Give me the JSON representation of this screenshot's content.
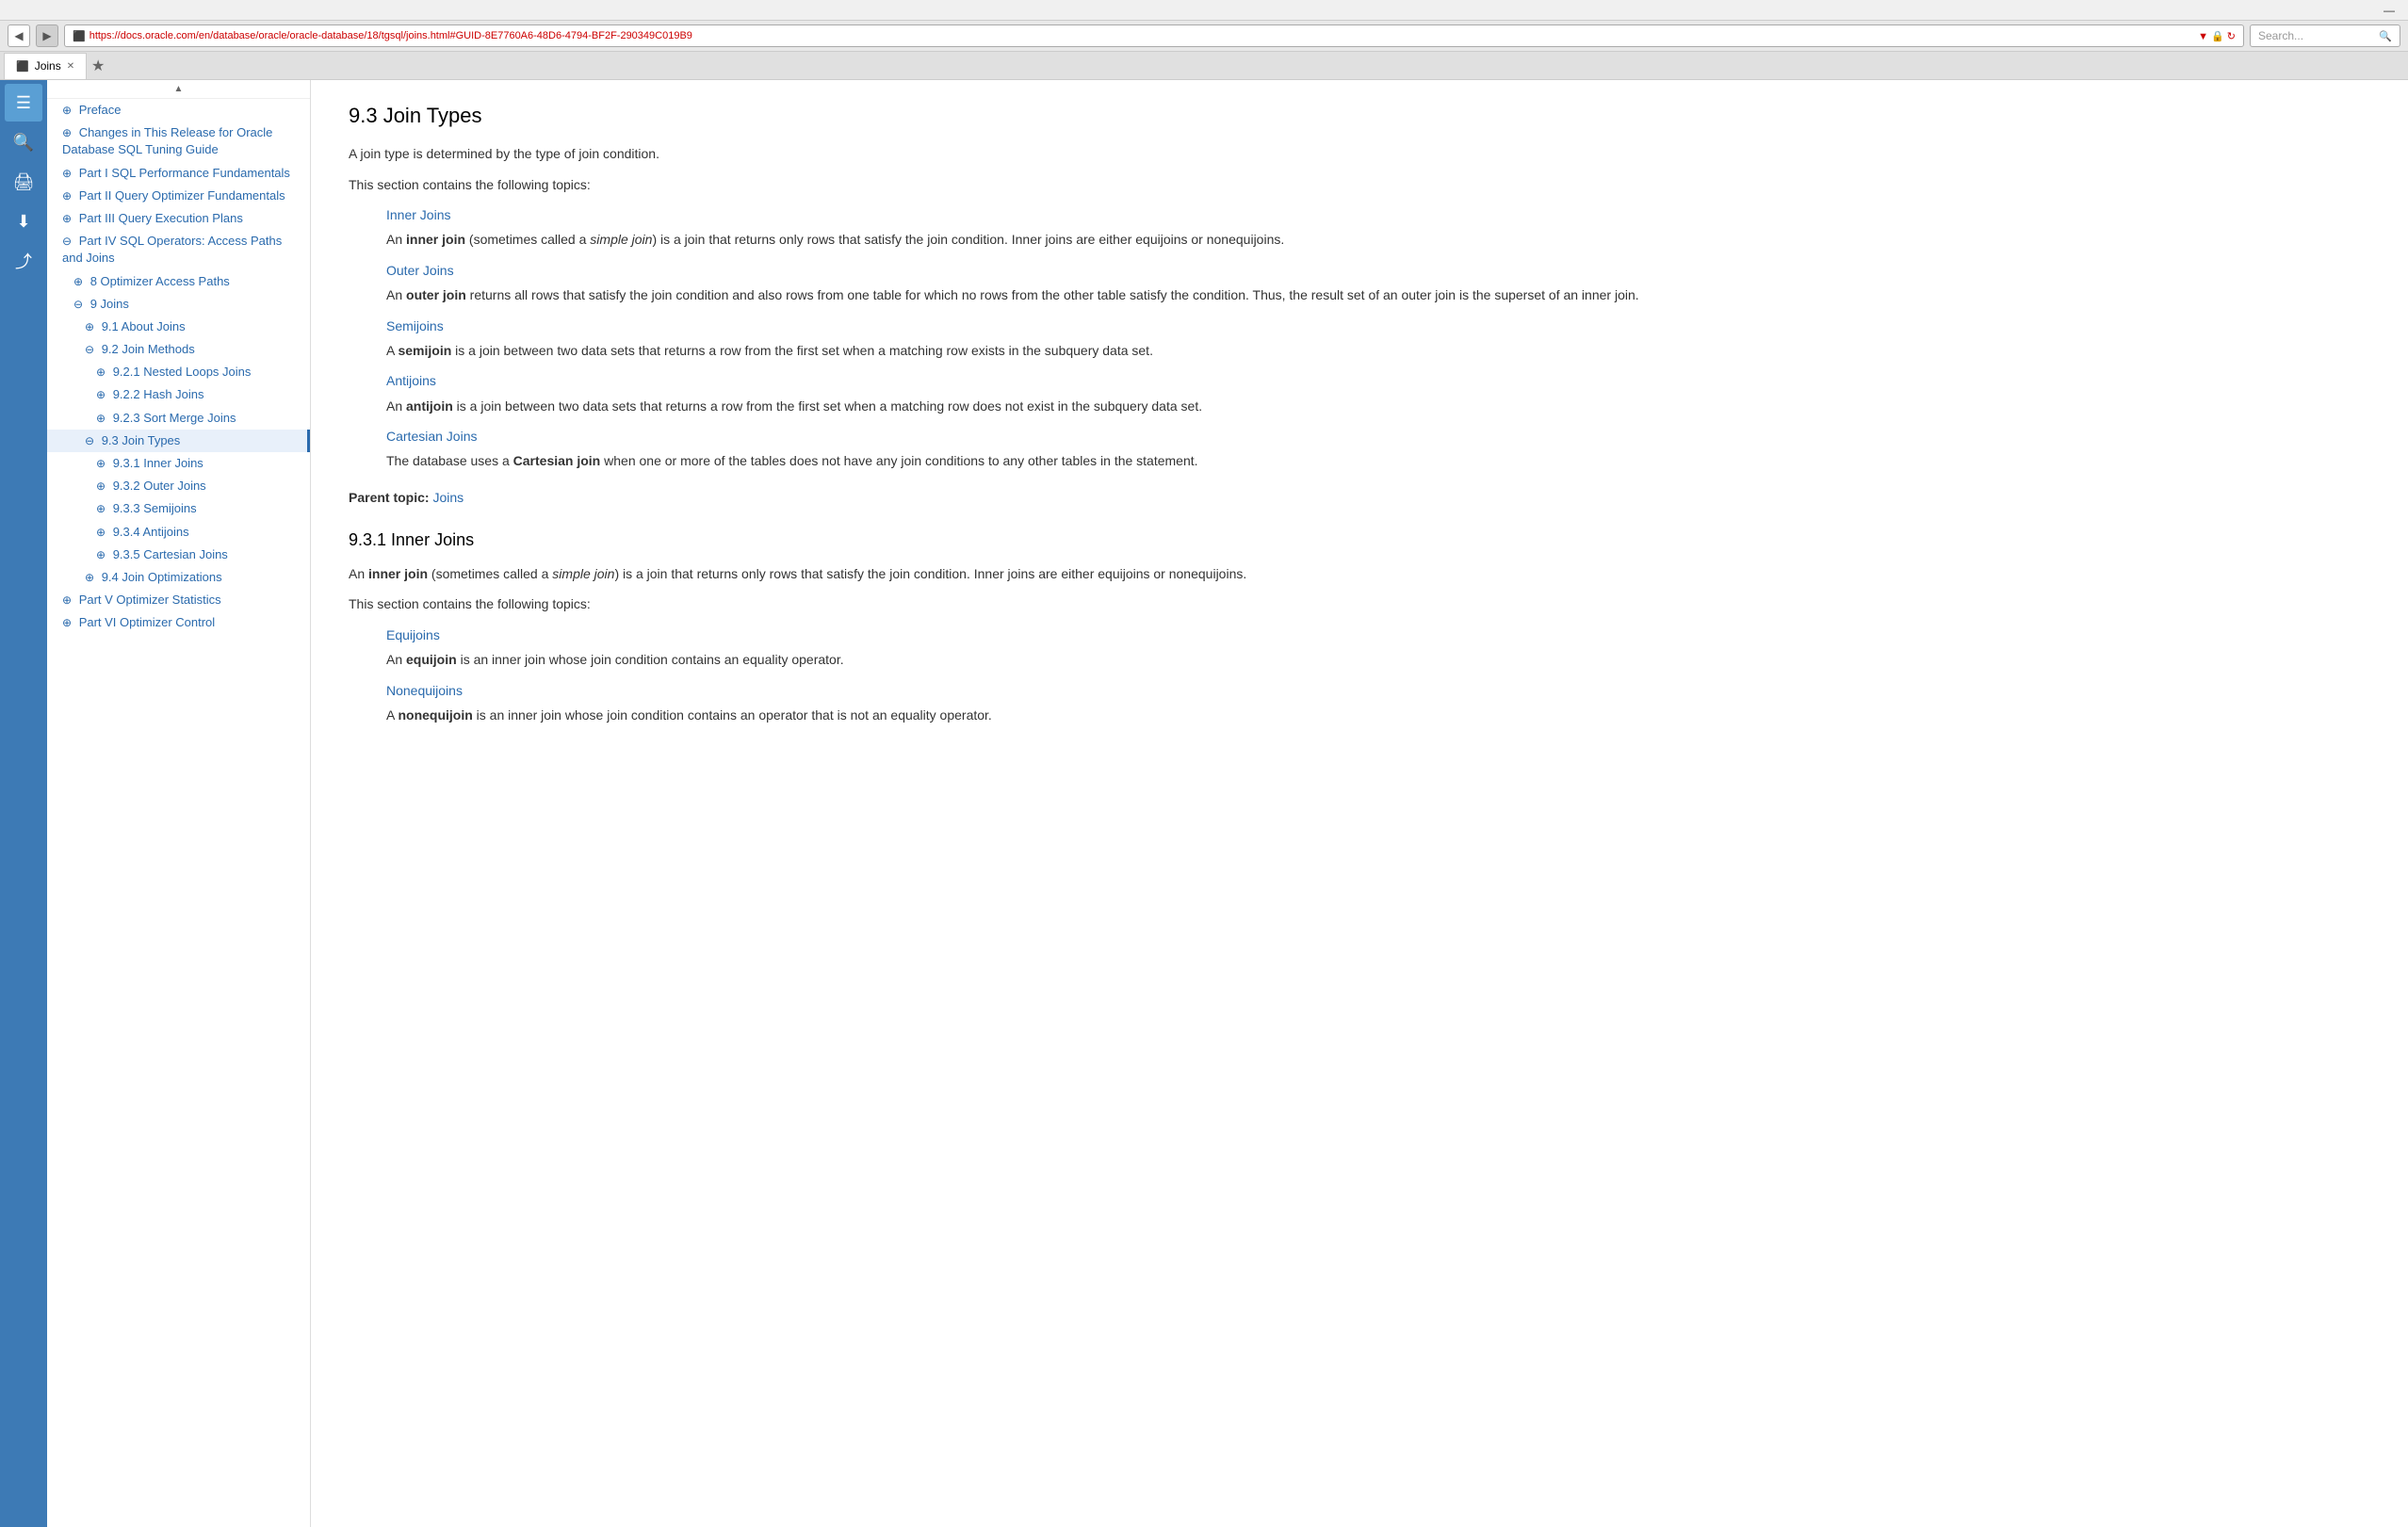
{
  "titlebar": {
    "minimize": "—"
  },
  "browser": {
    "back_icon": "◀",
    "forward_icon": "▶",
    "favicon": "⬛",
    "url": "https://docs.oracle.com/en/database/oracle/oracle-database/18/tgsql/joins.html#GUID-8E7760A6-48D6-4794-BF2F-290349C019B9",
    "lock_icon": "🔒",
    "refresh_icon": "↻",
    "search_placeholder": "Search...",
    "search_icon": "🔍"
  },
  "tab": {
    "favicon": "⬛",
    "label": "Joins",
    "close": "✕",
    "new_tab": "★"
  },
  "sidebar_icons": [
    {
      "name": "menu-icon",
      "glyph": "☰"
    },
    {
      "name": "search-icon",
      "glyph": "🔍"
    },
    {
      "name": "print-icon",
      "glyph": "🖨"
    },
    {
      "name": "download-icon",
      "glyph": "⬇"
    },
    {
      "name": "share-icon",
      "glyph": "⤴"
    }
  ],
  "toc": {
    "scroll_up": "▲",
    "items": [
      {
        "id": "preface",
        "level": 1,
        "icon": "plus",
        "label": "Preface",
        "active": false
      },
      {
        "id": "changes",
        "level": 1,
        "icon": "plus",
        "label": "Changes in This Release for Oracle Database SQL Tuning Guide",
        "active": false
      },
      {
        "id": "part1",
        "level": 1,
        "icon": "plus",
        "label": "Part I SQL Performance Fundamentals",
        "active": false
      },
      {
        "id": "part2",
        "level": 1,
        "icon": "plus",
        "label": "Part II Query Optimizer Fundamentals",
        "active": false
      },
      {
        "id": "part3",
        "level": 1,
        "icon": "plus",
        "label": "Part III Query Execution Plans",
        "active": false
      },
      {
        "id": "part4",
        "level": 1,
        "icon": "minus",
        "label": "Part IV SQL Operators: Access Paths and Joins",
        "active": false
      },
      {
        "id": "ch8",
        "level": 2,
        "icon": "plus",
        "label": "8 Optimizer Access Paths",
        "active": false
      },
      {
        "id": "ch9",
        "level": 2,
        "icon": "minus",
        "label": "9 Joins",
        "active": false
      },
      {
        "id": "sec91",
        "level": 3,
        "icon": "plus",
        "label": "9.1 About Joins",
        "active": false
      },
      {
        "id": "sec92",
        "level": 3,
        "icon": "minus",
        "label": "9.2 Join Methods",
        "active": false
      },
      {
        "id": "sec921",
        "level": 4,
        "icon": "plus",
        "label": "9.2.1 Nested Loops Joins",
        "active": false
      },
      {
        "id": "sec922",
        "level": 4,
        "icon": "plus",
        "label": "9.2.2 Hash Joins",
        "active": false
      },
      {
        "id": "sec923",
        "level": 4,
        "icon": "plus",
        "label": "9.2.3 Sort Merge Joins",
        "active": false
      },
      {
        "id": "sec93",
        "level": 3,
        "icon": "minus",
        "label": "9.3 Join Types",
        "active": true
      },
      {
        "id": "sec931",
        "level": 4,
        "icon": "plus",
        "label": "9.3.1 Inner Joins",
        "active": false
      },
      {
        "id": "sec932",
        "level": 4,
        "icon": "plus",
        "label": "9.3.2 Outer Joins",
        "active": false
      },
      {
        "id": "sec933",
        "level": 4,
        "icon": "plus",
        "label": "9.3.3 Semijoins",
        "active": false
      },
      {
        "id": "sec934",
        "level": 4,
        "icon": "plus",
        "label": "9.3.4 Antijoins",
        "active": false
      },
      {
        "id": "sec935",
        "level": 4,
        "icon": "plus",
        "label": "9.3.5 Cartesian Joins",
        "active": false
      },
      {
        "id": "sec94",
        "level": 3,
        "icon": "plus",
        "label": "9.4 Join Optimizations",
        "active": false
      },
      {
        "id": "part5",
        "level": 1,
        "icon": "plus",
        "label": "Part V Optimizer Statistics",
        "active": false
      },
      {
        "id": "part6",
        "level": 1,
        "icon": "plus",
        "label": "Part VI Optimizer Control",
        "active": false
      }
    ]
  },
  "content": {
    "main_title": "9.3 Join Types",
    "intro1": "A join type is determined by the type of join condition.",
    "intro2": "This section contains the following topics:",
    "sections": [
      {
        "link_label": "Inner Joins",
        "desc_prefix": "An ",
        "desc_bold": "inner join",
        "desc_italic": "simple join",
        "desc_middle": " (sometimes called a ",
        "desc_end": ") is a join that returns only rows that satisfy the join condition. Inner joins are either equijoins or nonequijoins."
      },
      {
        "link_label": "Outer Joins",
        "desc_prefix": "An ",
        "desc_bold": "outer join",
        "desc_end": " returns all rows that satisfy the join condition and also rows from one table for which no rows from the other table satisfy the condition. Thus, the result set of an outer join is the superset of an inner join."
      },
      {
        "link_label": "Semijoins",
        "desc_prefix": "A ",
        "desc_bold": "semijoin",
        "desc_end": " is a join between two data sets that returns a row from the first set when a matching row exists in the subquery data set."
      },
      {
        "link_label": "Antijoins",
        "desc_prefix": "An ",
        "desc_bold": "antijoin",
        "desc_end": " is a join between two data sets that returns a row from the first set when a matching row does not exist in the subquery data set."
      },
      {
        "link_label": "Cartesian Joins",
        "desc_prefix": "The database uses a ",
        "desc_bold": "Cartesian join",
        "desc_end": " when one or more of the tables does not have any join conditions to any other tables in the statement."
      }
    ],
    "parent_topic_label": "Parent topic:",
    "parent_topic_link": "Joins",
    "subsection_title": "9.3.1 Inner Joins",
    "subsection_intro_prefix": "An ",
    "subsection_intro_bold": "inner join",
    "subsection_intro_italic": "simple join",
    "subsection_intro_middle": " (sometimes called a ",
    "subsection_intro_end": ") is a join that returns only rows that satisfy the join condition. Inner joins are either equijoins or nonequijoins.",
    "subsection_topics_intro": "This section contains the following topics:",
    "subsection_links": [
      {
        "link_label": "Equijoins",
        "desc_prefix": "An ",
        "desc_bold": "equijoin",
        "desc_end": " is an inner join whose join condition contains an equality operator."
      },
      {
        "link_label": "Nonequijoins",
        "desc_prefix": "A ",
        "desc_bold": "nonequijoin",
        "desc_end": " is an inner join whose join condition contains an operator that is not an equality operator."
      }
    ]
  }
}
